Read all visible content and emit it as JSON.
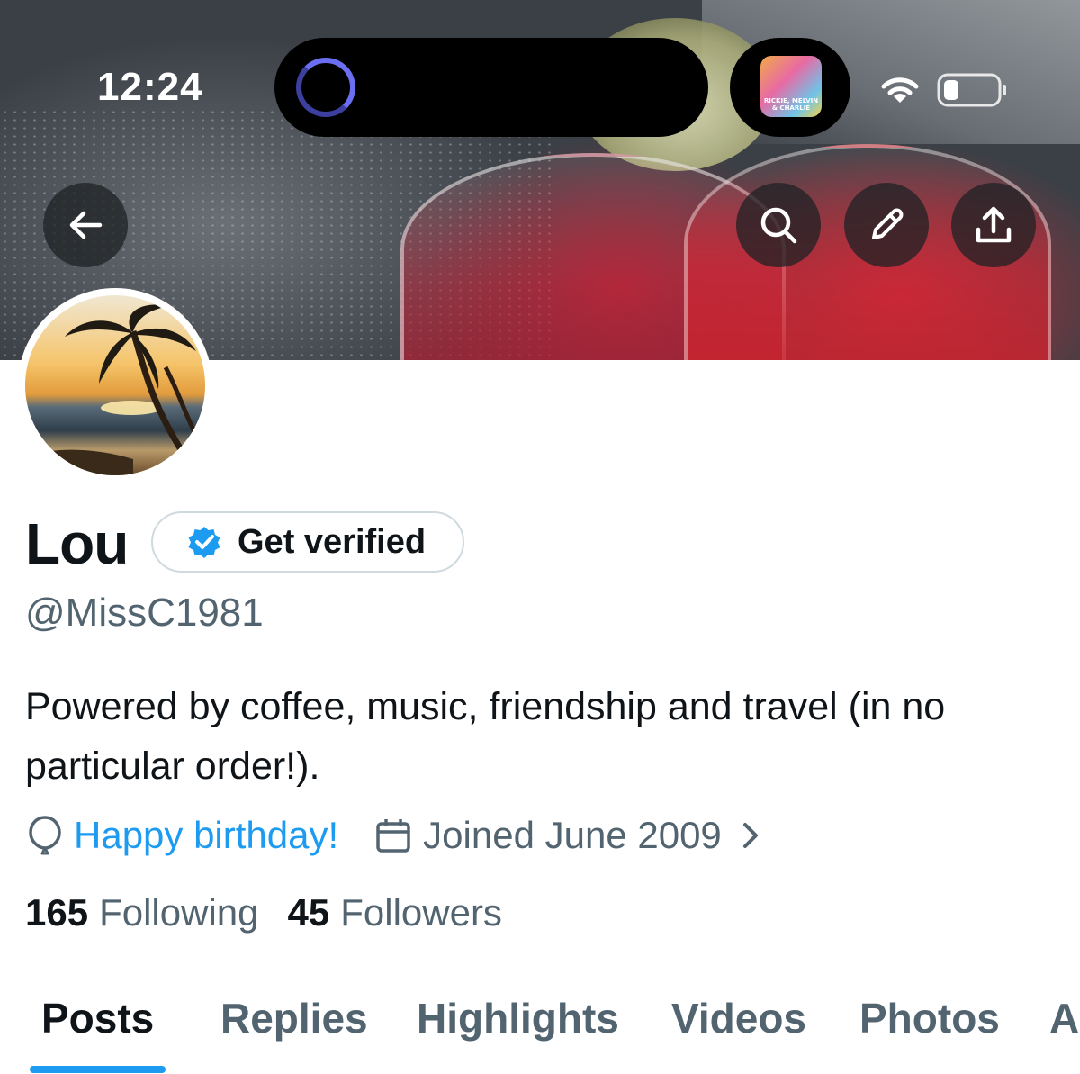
{
  "status_bar": {
    "time": "12:24",
    "podcast_art_text": "RICKIE, MELVIN & CHARLIE",
    "icons": [
      "wifi-icon",
      "battery-icon"
    ]
  },
  "banner": {
    "buttons": [
      "back-arrow-icon",
      "search-icon",
      "pencil-icon",
      "share-icon"
    ]
  },
  "profile": {
    "name": "Lou",
    "verify_label": "Get verified",
    "handle": "@MissC1981",
    "bio": "Powered by coffee, music, friendship and travel (in no particular order!).",
    "birthday": "Happy birthday!",
    "joined": "Joined June 2009",
    "following_count": "165",
    "following_label": "Following",
    "followers_count": "45",
    "followers_label": "Followers"
  },
  "tabs": [
    {
      "label": "Posts",
      "active": true
    },
    {
      "label": "Replies",
      "active": false
    },
    {
      "label": "Highlights",
      "active": false
    },
    {
      "label": "Videos",
      "active": false
    },
    {
      "label": "Photos",
      "active": false
    },
    {
      "label": "A",
      "active": false
    }
  ],
  "colors": {
    "accent": "#1d9bf0",
    "text_primary": "#0f1419",
    "text_secondary": "#536471"
  }
}
